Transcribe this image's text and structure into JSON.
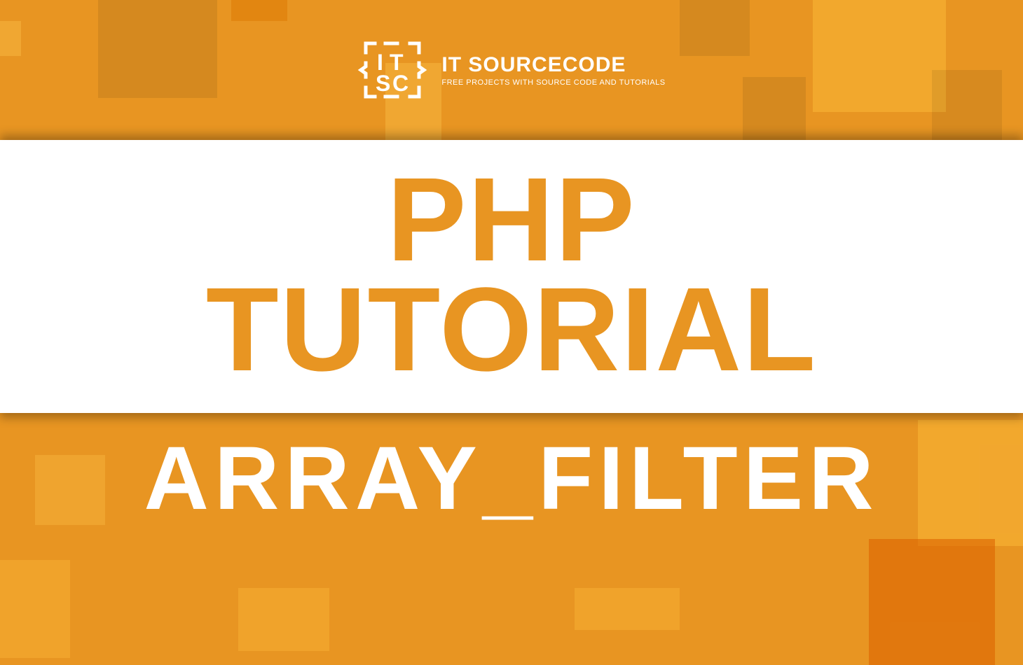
{
  "logo": {
    "title": "IT SOURCECODE",
    "subtitle": "FREE PROJECTS WITH SOURCE CODE AND TUTORIALS"
  },
  "headline": {
    "line1": "PHP",
    "line2": "TUTORIAL"
  },
  "subtopic": "ARRAY_FILTER",
  "colors": {
    "brand_orange": "#e89522",
    "text_white": "#ffffff"
  }
}
